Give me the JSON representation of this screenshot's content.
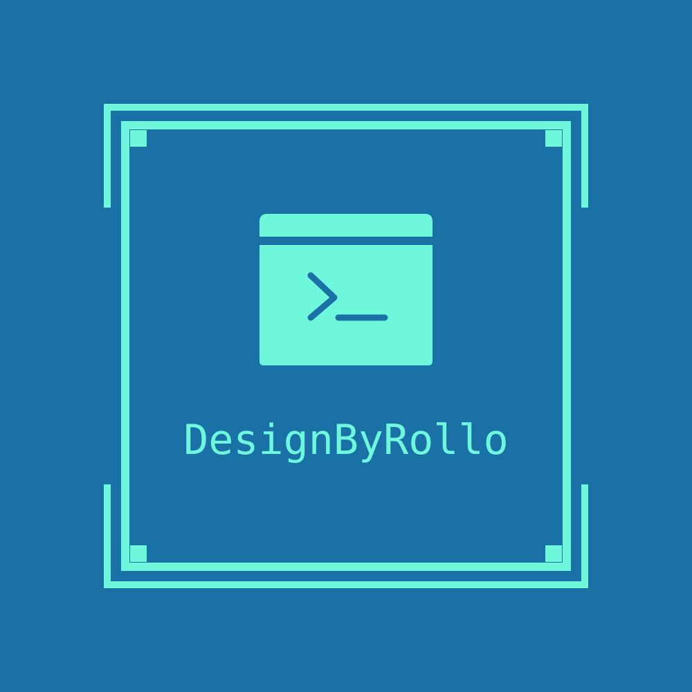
{
  "logo": {
    "brand_name": "DesignByRollo",
    "icon": "terminal-window-icon",
    "colors": {
      "background": "#1a71a6",
      "accent": "#6ff7dc"
    }
  }
}
